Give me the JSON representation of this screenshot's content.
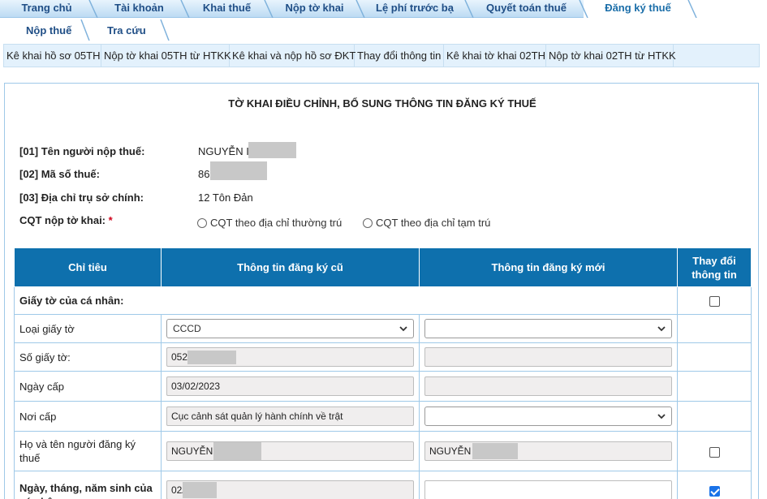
{
  "top_tabs": [
    {
      "label": "Trang chủ",
      "active": false
    },
    {
      "label": "Tài khoản",
      "active": false
    },
    {
      "label": "Khai thuế",
      "active": false
    },
    {
      "label": "Nộp tờ khai",
      "active": false
    },
    {
      "label": "Lệ phí trước bạ",
      "active": false
    },
    {
      "label": "Quyết toán thuế",
      "active": false
    },
    {
      "label": "Đăng ký thuế",
      "active": true
    }
  ],
  "sub_tabs": [
    "Nộp thuế",
    "Tra cứu"
  ],
  "menu_items": [
    "Kê khai hồ sơ 05TH",
    "Nộp tờ khai 05TH từ HTKK",
    "Kê khai và nộp hồ sơ ĐKT",
    "Thay đổi thông tin",
    "Kê khai tờ khai 02TH",
    "Nộp tờ khai 02TH từ HTKK"
  ],
  "form": {
    "title": "TỜ KHAI ĐIỀU CHỈNH, BỔ SUNG THÔNG TIN ĐĂNG KÝ THUẾ",
    "taxpayer_name_label": "[01] Tên người nộp thuế:",
    "taxpayer_name_value": "NGUYỄN I",
    "tax_code_label": "[02] Mã số thuế:",
    "tax_code_value": "86",
    "address_label": "[03] Địa chỉ trụ sở chính:",
    "address_value": "12 Tôn Đản",
    "cqt_label": "CQT nộp tờ khai:",
    "cqt_required_mark": "*",
    "cqt_options": [
      "CQT theo địa chỉ thường trú",
      "CQT theo địa chỉ tạm trú"
    ]
  },
  "table": {
    "headers": [
      "Chỉ tiêu",
      "Thông tin đăng ký cũ",
      "Thông tin đăng ký mới",
      "Thay đổi thông tin"
    ],
    "rows": [
      {
        "label": "Giấy tờ của cá nhân:",
        "old": "",
        "new": "",
        "checked": false
      },
      {
        "label": "Loại giấy tờ",
        "old": "CCCD",
        "new": "",
        "checked": null
      },
      {
        "label": "Số giấy tờ:",
        "old": "052",
        "new": "",
        "checked": null
      },
      {
        "label": "Ngày cấp",
        "old": "03/02/2023",
        "new": "",
        "checked": null
      },
      {
        "label": "Nơi cấp",
        "old": "Cục cảnh sát quản lý hành chính về trật",
        "new": "",
        "checked": null
      },
      {
        "label": "Họ và tên người đăng ký thuế",
        "old": "NGUYỄN",
        "new": "NGUYỄN I",
        "checked": false
      },
      {
        "label": "Ngày, tháng, năm sinh của cá nhân",
        "old": "02/",
        "new": "",
        "checked": true
      }
    ]
  },
  "colors": {
    "header_blue": "#0e70ad",
    "tab_text": "#1f4e86",
    "menu_bg": "#e3f1fc"
  },
  "icons": [
    "chevron-down-icon",
    "tab-separator"
  ]
}
